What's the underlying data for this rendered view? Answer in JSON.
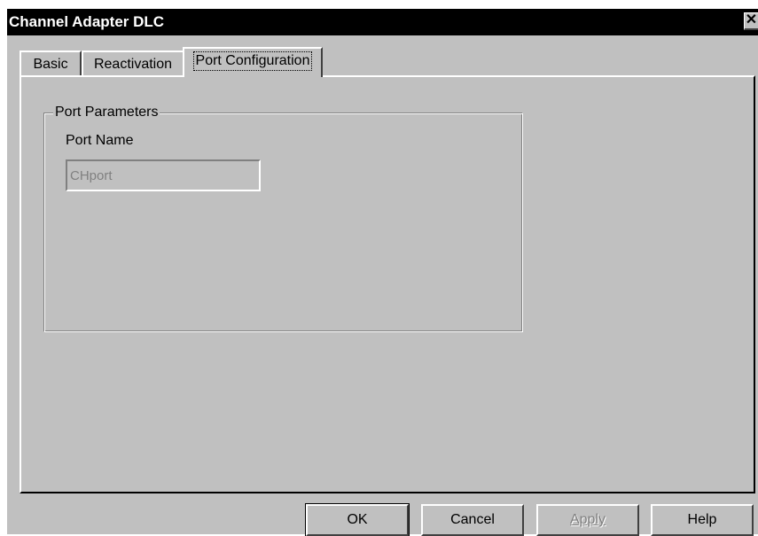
{
  "window": {
    "title": "Channel Adapter DLC",
    "close_glyph": "✕"
  },
  "tabs": [
    {
      "label": "Basic",
      "active": false
    },
    {
      "label": "Reactivation",
      "active": false
    },
    {
      "label": "Port Configuration",
      "active": true
    }
  ],
  "port_parameters": {
    "group_label": "Port Parameters",
    "port_name_label": "Port Name",
    "port_name_value": "CHport"
  },
  "buttons": {
    "ok": "OK",
    "cancel": "Cancel",
    "apply": "Apply",
    "help": "Help"
  },
  "colors": {
    "dialog_face": "#c0c0c0",
    "titlebar": "#000000",
    "disabled_text": "#808080"
  }
}
